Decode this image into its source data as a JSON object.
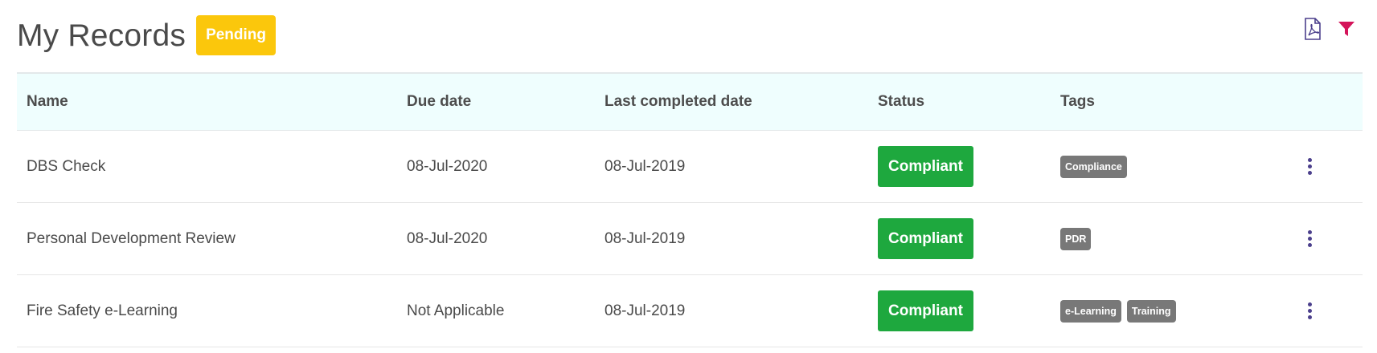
{
  "header": {
    "title": "My Records",
    "pending_label": "Pending",
    "pdf_icon": "pdf-file-icon",
    "filter_icon": "filter-icon"
  },
  "colors": {
    "pending": "#fbc70c",
    "compliant": "#1ea83e",
    "tag": "#787878",
    "header_bg": "#effefe",
    "accent_purple": "#4b3f8c",
    "filter_pink": "#d4145a"
  },
  "table": {
    "columns": [
      "Name",
      "Due date",
      "Last completed date",
      "Status",
      "Tags"
    ],
    "rows": [
      {
        "name": "DBS Check",
        "due_date": "08-Jul-2020",
        "last_completed": "08-Jul-2019",
        "status": "Compliant",
        "tags": [
          "Compliance"
        ]
      },
      {
        "name": "Personal Development Review",
        "due_date": "08-Jul-2020",
        "last_completed": "08-Jul-2019",
        "status": "Compliant",
        "tags": [
          "PDR"
        ]
      },
      {
        "name": "Fire Safety e-Learning",
        "due_date": "Not Applicable",
        "last_completed": "08-Jul-2019",
        "status": "Compliant",
        "tags": [
          "e-Learning",
          "Training"
        ]
      }
    ]
  }
}
